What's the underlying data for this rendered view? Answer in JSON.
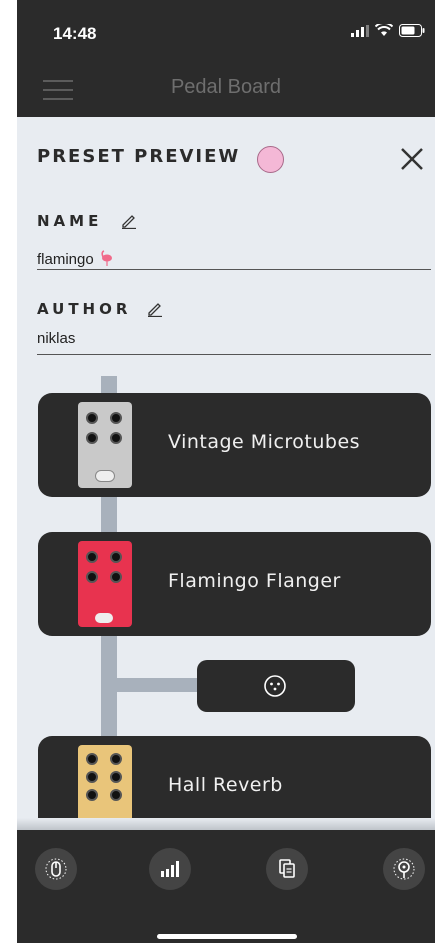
{
  "status_bar": {
    "time": "14:48"
  },
  "header": {
    "title": "Pedal Board"
  },
  "preview": {
    "title": "PRESET PREVIEW",
    "color": "#f4b8d6"
  },
  "fields": {
    "name_label": "NAME",
    "name_value": "flamingo",
    "author_label": "AUTHOR",
    "author_value": "niklas"
  },
  "pedals": [
    {
      "name": "Vintage Microtubes",
      "color": "#c9c9c9"
    },
    {
      "name": "Flamingo Flanger",
      "color": "#e8334f"
    },
    {
      "name": "Hall Reverb",
      "color": "#e9c57a"
    }
  ],
  "bottom_nav": [
    {
      "icon": "tuner-knob-icon"
    },
    {
      "icon": "levels-icon"
    },
    {
      "icon": "copy-icon"
    },
    {
      "icon": "pin-icon"
    }
  ]
}
